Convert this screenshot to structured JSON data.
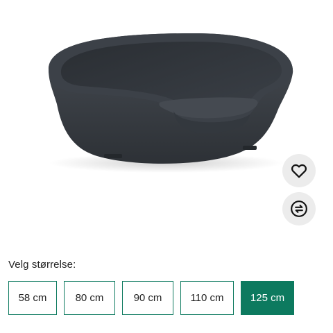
{
  "product": {
    "image_icon": "dog-bed-product-image"
  },
  "actions": {
    "favorite_icon": "heart-icon",
    "compare_icon": "compare-arrows-icon"
  },
  "size_selector": {
    "label": "Velg størrelse:",
    "options": [
      {
        "label": "58 cm",
        "selected": false
      },
      {
        "label": "80 cm",
        "selected": false
      },
      {
        "label": "90 cm",
        "selected": false
      },
      {
        "label": "110 cm",
        "selected": false
      },
      {
        "label": "125 cm",
        "selected": true
      }
    ]
  },
  "colors": {
    "accent": "#0d7a5f",
    "button_bg": "#ececec",
    "product_dark": "#3a3f45"
  }
}
